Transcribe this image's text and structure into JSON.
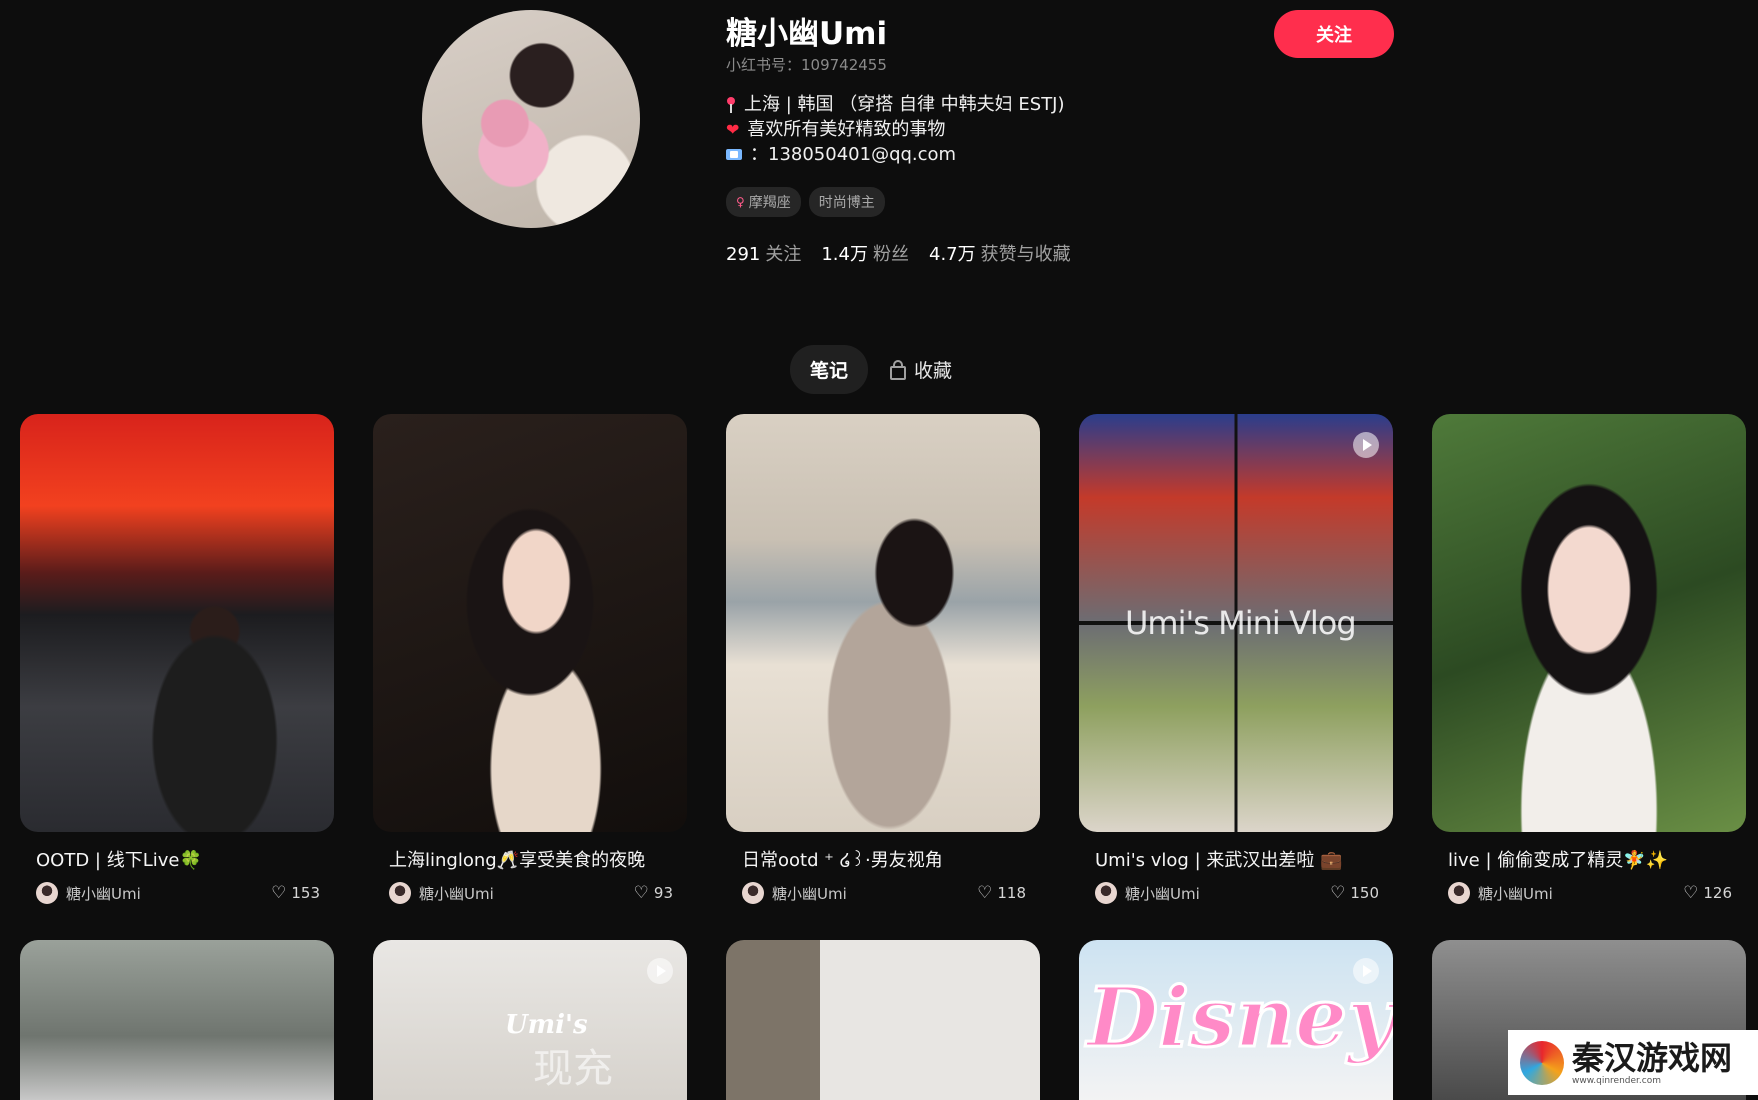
{
  "profile": {
    "name": "糖小幽Umi",
    "red_id": "小红书号：109742455",
    "follow_label": "关注",
    "bio": [
      "上海 | 韩国 （穿搭 自律 中韩夫妇 ESTJ)",
      "喜欢所有美好精致的事物",
      "：138050401@qq.com"
    ],
    "tags": [
      "摩羯座",
      "时尚博主"
    ],
    "stats": [
      {
        "value": "291",
        "label": "关注"
      },
      {
        "value": "1.4万",
        "label": "粉丝"
      },
      {
        "value": "4.7万",
        "label": "获赞与收藏"
      }
    ]
  },
  "tabs": {
    "notes": "笔记",
    "favorites": "收藏"
  },
  "notes": [
    {
      "title": "OOTD | 线下Live🍀",
      "author": "糖小幽Umi",
      "likes": "153"
    },
    {
      "title": "上海linglong🥂享受美食的夜晚",
      "author": "糖小幽Umi",
      "likes": "93"
    },
    {
      "title": "日常ootd ⁺ ໒꒱·男友视角",
      "author": "糖小幽Umi",
      "likes": "118"
    },
    {
      "title": "Umi's vlog | 来武汉出差啦 💼",
      "author": "糖小幽Umi",
      "likes": "150"
    },
    {
      "title": "live | 偷偷变成了精灵🧚✨",
      "author": "糖小幽Umi",
      "likes": "126"
    }
  ],
  "overlays": {
    "vlog": "Umi's Mini Vlog",
    "disney": "Disney",
    "umis": "Umi's",
    "umis_sub": "现充"
  },
  "watermark": {
    "text": "秦汉游戏网",
    "url": "www.qinrender.com"
  },
  "colors": {
    "accent": "#ff2e4d",
    "background": "#0d0d0d"
  }
}
